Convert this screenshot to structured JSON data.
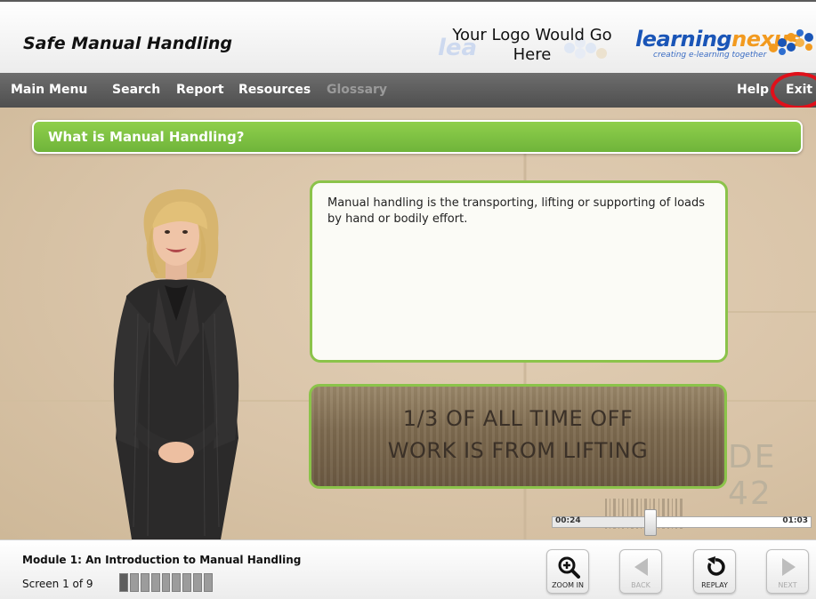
{
  "header": {
    "course_title": "Safe Manual Handling",
    "logo_placeholder": "Your Logo Would Go Here",
    "brand_part1": "learning",
    "brand_part2": "nexus",
    "brand_tagline": "creating e-learning together"
  },
  "menu": {
    "main_menu": "Main Menu",
    "search": "Search",
    "report": "Report",
    "resources": "Resources",
    "glossary": "Glossary",
    "help": "Help",
    "exit": "Exit"
  },
  "slide": {
    "title": "What is Manual Handling?",
    "body": "Manual handling is the transporting, lifting or supporting of loads by hand or bodily effort.",
    "fact_line1": "1/3 OF ALL TIME OFF",
    "fact_line2": "WORK IS FROM LIFTING",
    "background_text": "DE 42"
  },
  "timeline": {
    "current": "00:24",
    "total": "01:03",
    "progress_fraction": 0.38
  },
  "footer": {
    "module_title": "Module 1: An Introduction to Manual Handling",
    "screen_label": "Screen 1 of 9",
    "screens_total": 9,
    "screens_done": 1,
    "zoom_in": "ZOOM IN",
    "back": "BACK",
    "replay": "REPLAY",
    "next": "NEXT"
  },
  "colors": {
    "accent_green": "#7dbf43",
    "menubar": "#5a5a5a",
    "exit_highlight": "#e0101a",
    "brand_blue": "#1a55b7",
    "brand_orange": "#f29a1f"
  }
}
